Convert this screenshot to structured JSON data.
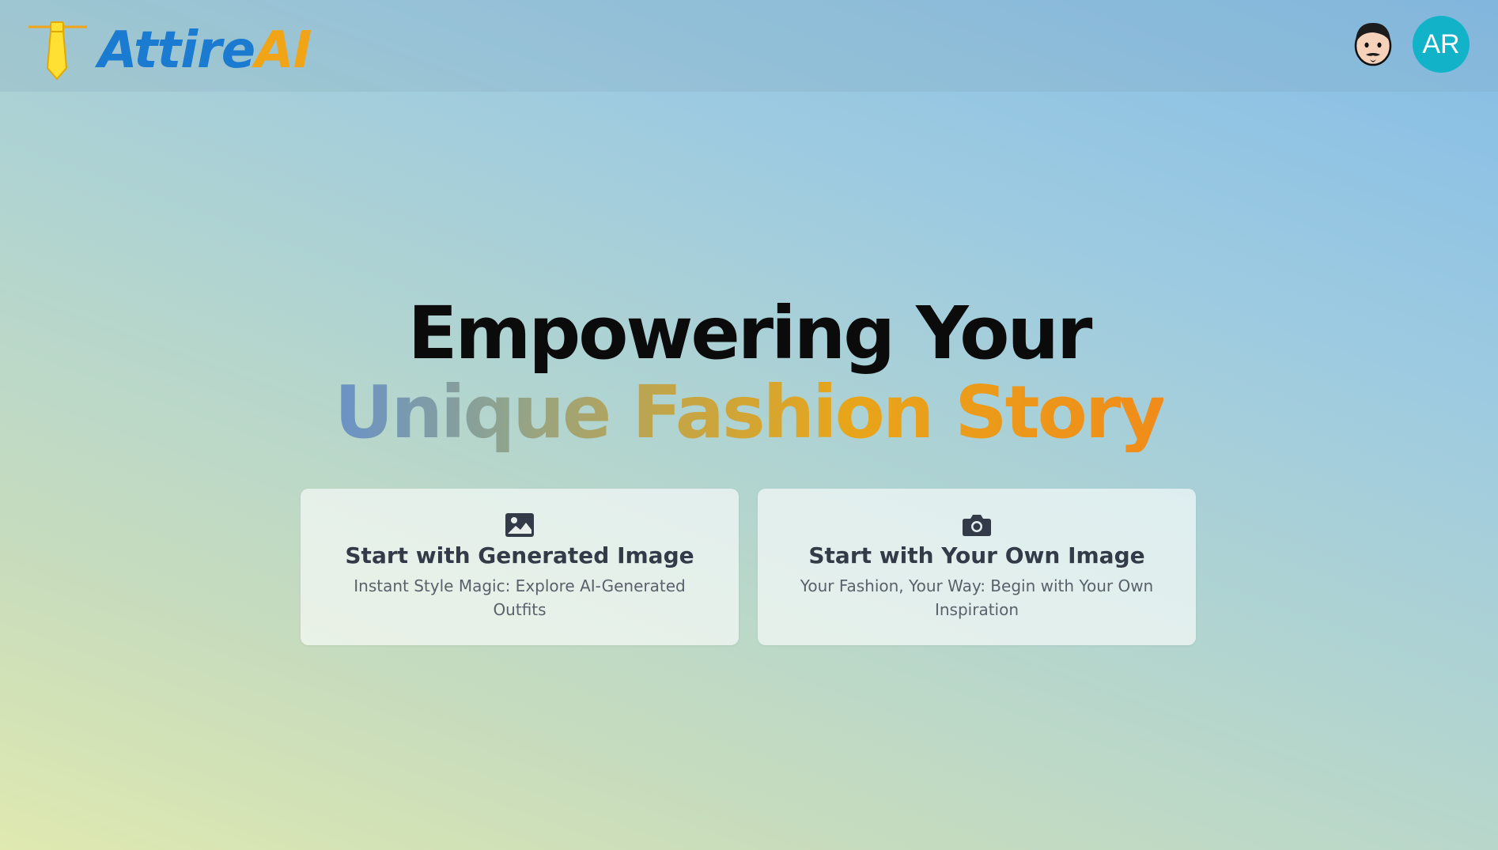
{
  "header": {
    "brand": {
      "part1": "Attire",
      "part2": "AI",
      "icon": "tie-icon"
    },
    "user_icon": "man-face-icon",
    "avatar_initials": "AR"
  },
  "hero": {
    "line1": "Empowering Your",
    "line2": "Unique Fashion Story"
  },
  "cards": [
    {
      "icon": "image-icon",
      "title": "Start with Generated Image",
      "subtitle": "Instant Style Magic: Explore AI-Generated Outfits"
    },
    {
      "icon": "camera-icon",
      "title": "Start with Your Own Image",
      "subtitle": "Your Fashion, Your Way: Begin with Your Own Inspiration"
    }
  ],
  "colors": {
    "brand_blue": "#1b7bd1",
    "brand_orange": "#f2a417",
    "avatar_bg": "#12b3c8",
    "headline_dark": "#0b0b0b"
  }
}
